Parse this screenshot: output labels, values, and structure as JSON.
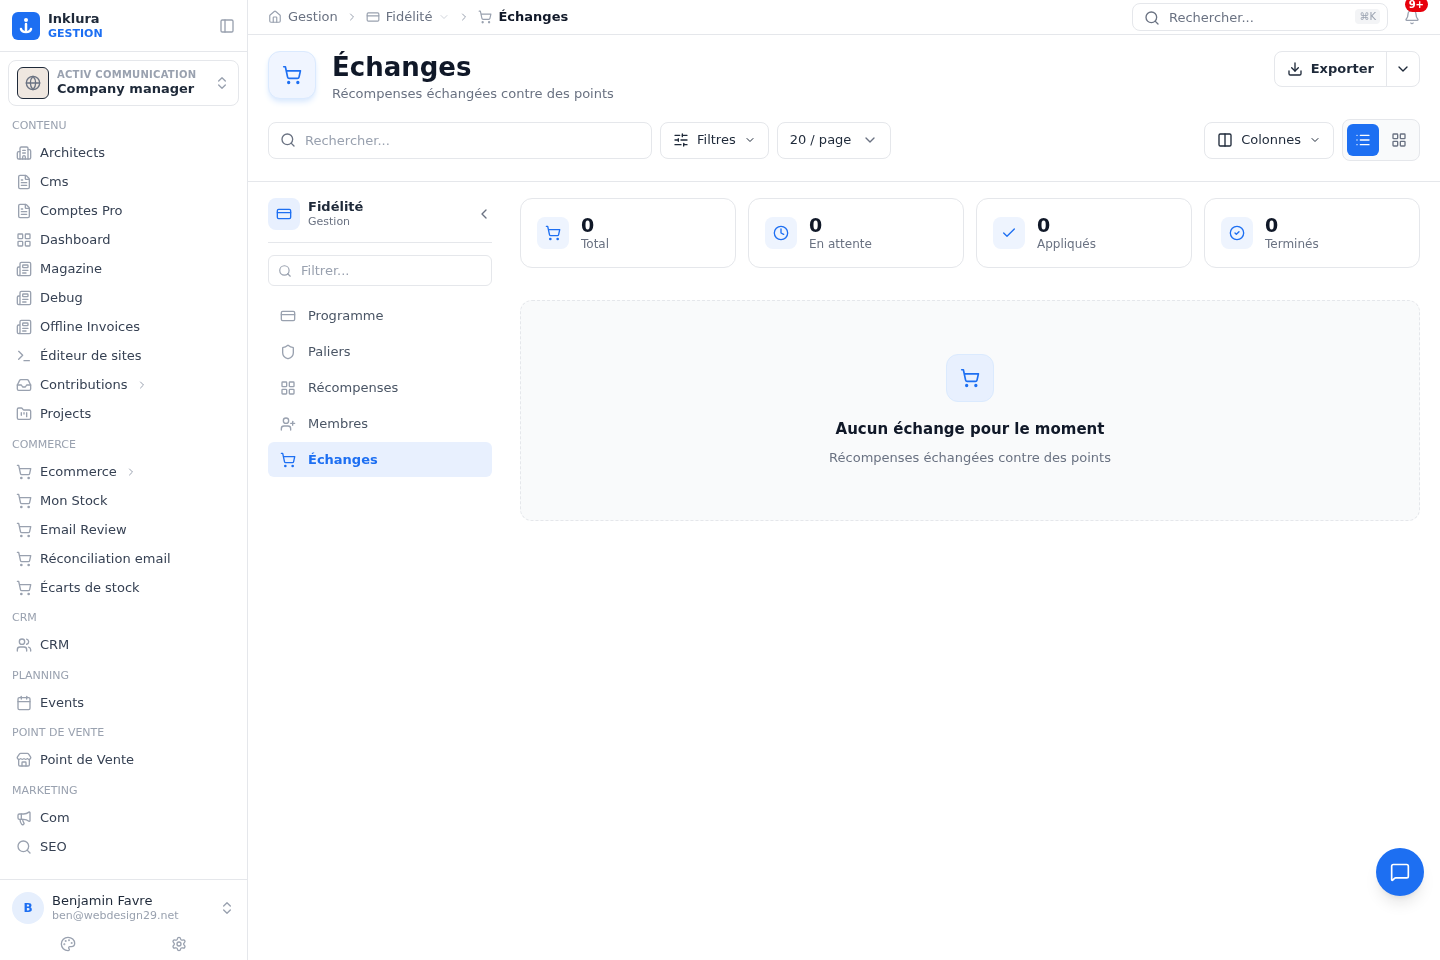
{
  "brand": {
    "name": "Inklura",
    "subtitle": "GESTION"
  },
  "workspace": {
    "org": "ACTIV COMMUNICATION",
    "role": "Company manager"
  },
  "sidebar": {
    "sections": [
      {
        "title": "CONTENU",
        "items": [
          {
            "label": "Architects",
            "has_children": false
          },
          {
            "label": "Cms",
            "has_children": false
          },
          {
            "label": "Comptes Pro",
            "has_children": false
          },
          {
            "label": "Dashboard",
            "has_children": false
          },
          {
            "label": "Magazine",
            "has_children": false
          },
          {
            "label": "Debug",
            "has_children": false
          },
          {
            "label": "Offline Invoices",
            "has_children": false
          },
          {
            "label": "Éditeur de sites",
            "has_children": false
          },
          {
            "label": "Contributions",
            "has_children": true
          },
          {
            "label": "Projects",
            "has_children": false
          }
        ]
      },
      {
        "title": "COMMERCE",
        "items": [
          {
            "label": "Ecommerce",
            "has_children": true
          },
          {
            "label": "Mon Stock",
            "has_children": false
          },
          {
            "label": "Email Review",
            "has_children": false
          },
          {
            "label": "Réconciliation email",
            "has_children": false
          },
          {
            "label": "Écarts de stock",
            "has_children": false
          }
        ]
      },
      {
        "title": "CRM",
        "items": [
          {
            "label": "CRM",
            "has_children": false
          }
        ]
      },
      {
        "title": "PLANNING",
        "items": [
          {
            "label": "Events",
            "has_children": false
          }
        ]
      },
      {
        "title": "POINT DE VENTE",
        "items": [
          {
            "label": "Point de Vente",
            "has_children": false
          }
        ]
      },
      {
        "title": "MARKETING",
        "items": [
          {
            "label": "Com",
            "has_children": false
          },
          {
            "label": "SEO",
            "has_children": false
          }
        ]
      }
    ]
  },
  "user": {
    "initial": "B",
    "name": "Benjamin Favre",
    "email": "ben@webdesign29.net"
  },
  "breadcrumb": [
    {
      "label": "Gestion"
    },
    {
      "label": "Fidélité"
    },
    {
      "label": "Échanges"
    }
  ],
  "topbar": {
    "search_placeholder": "Rechercher...",
    "shortcut": "⌘K",
    "notifications": "9+"
  },
  "page": {
    "title": "Échanges",
    "subtitle": "Récompenses échangées contre des points",
    "export": "Exporter"
  },
  "toolbar": {
    "search_placeholder": "Rechercher...",
    "filters": "Filtres",
    "page_size": "20 / page",
    "columns": "Colonnes",
    "view_modes": [
      {
        "selected": true
      },
      {
        "selected": false
      }
    ]
  },
  "module": {
    "title": "Fidélité",
    "subtitle": "Gestion",
    "filter_placeholder": "Filtrer...",
    "items": [
      {
        "label": "Programme",
        "selected": false
      },
      {
        "label": "Paliers",
        "selected": false
      },
      {
        "label": "Récompenses",
        "selected": false
      },
      {
        "label": "Membres",
        "selected": false
      },
      {
        "label": "Échanges",
        "selected": true
      }
    ]
  },
  "stats": [
    {
      "value": "0",
      "label": "Total"
    },
    {
      "value": "0",
      "label": "En attente"
    },
    {
      "value": "0",
      "label": "Appliqués"
    },
    {
      "value": "0",
      "label": "Terminés"
    }
  ],
  "empty_state": {
    "title": "Aucun échange pour le moment",
    "text": "Récompenses échangées contre des points"
  }
}
